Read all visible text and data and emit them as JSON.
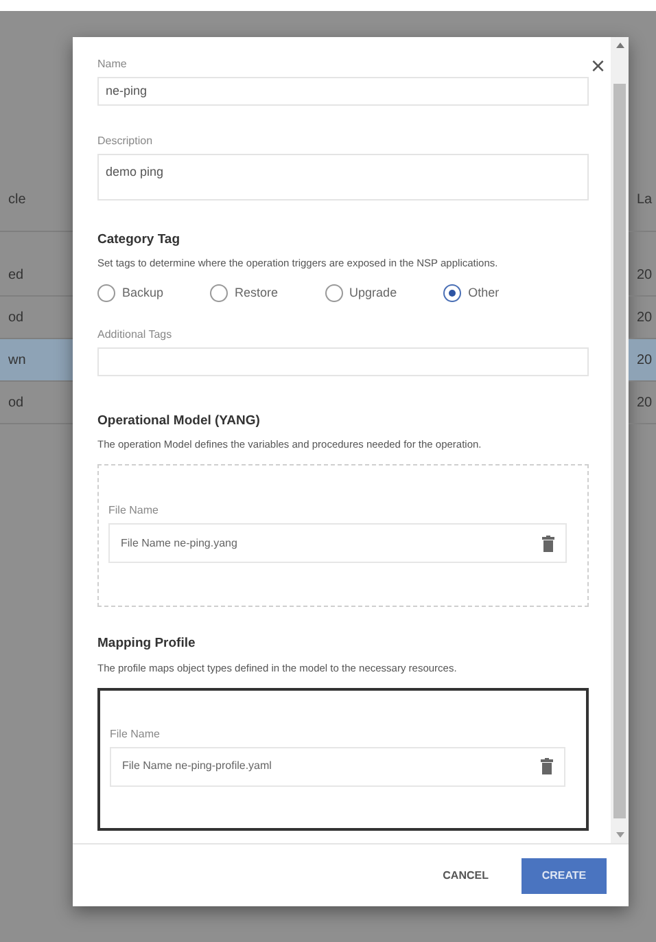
{
  "background_table": {
    "columns": [
      "cle",
      "La"
    ],
    "rows": [
      {
        "cells": [
          "ed",
          "20"
        ],
        "selected": false
      },
      {
        "cells": [
          "od",
          "20"
        ],
        "selected": false
      },
      {
        "cells": [
          "wn",
          "20"
        ],
        "selected": true
      },
      {
        "cells": [
          "od",
          "20"
        ],
        "selected": false
      }
    ]
  },
  "dialog": {
    "close": "×",
    "fields": [
      {
        "label": "Name",
        "value": "ne-ping",
        "kind": "input"
      },
      {
        "label": "Description",
        "value": "demo ping",
        "kind": "textarea"
      }
    ],
    "category_tag": {
      "title": "Category Tag",
      "description": "Set tags to determine where the operation triggers are exposed in the NSP applications.",
      "options": [
        {
          "label": "Backup",
          "selected": false
        },
        {
          "label": "Restore",
          "selected": false
        },
        {
          "label": "Upgrade",
          "selected": false
        },
        {
          "label": "Other",
          "selected": true
        }
      ]
    },
    "additional_tags": {
      "label": "Additional Tags"
    },
    "sections": [
      {
        "title": "Operational Model (YANG)",
        "description": "The operation Model defines the variables and procedures needed for the operation.",
        "focused": false,
        "file": {
          "label": "File Name",
          "value": "File Name ne-ping.yang"
        }
      },
      {
        "title": "Mapping Profile",
        "description": "The profile maps object types defined in the model to the necessary resources.",
        "focused": true,
        "file": {
          "label": "File Name",
          "value": "File Name ne-ping-profile.yaml"
        }
      }
    ],
    "buttons": [
      {
        "label": "CANCEL",
        "kind": "text"
      },
      {
        "label": "CREATE",
        "kind": "primary"
      }
    ]
  }
}
